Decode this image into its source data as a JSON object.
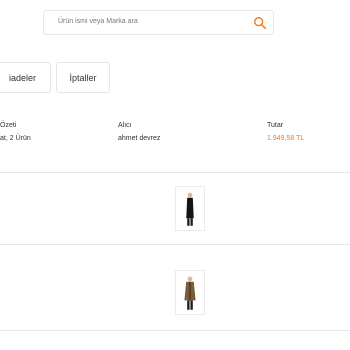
{
  "search": {
    "placeholder": "Ürün ismi veya Marka ara",
    "icon": "search-icon"
  },
  "tabs": [
    {
      "label": "iadeler"
    },
    {
      "label": "İptaller"
    }
  ],
  "order": {
    "summary_label": "Özeti",
    "summary_value": "at, 2 Ürün",
    "buyer_label": "Alıcı",
    "buyer_value": "ahmet devrez",
    "amount_label": "Tutar",
    "amount_value": "1.949,58 TL"
  },
  "products": [
    {
      "image": "black-vest-product-image"
    },
    {
      "image": "brown-jacket-product-image"
    }
  ],
  "colors": {
    "accent": "#f27a1a"
  }
}
